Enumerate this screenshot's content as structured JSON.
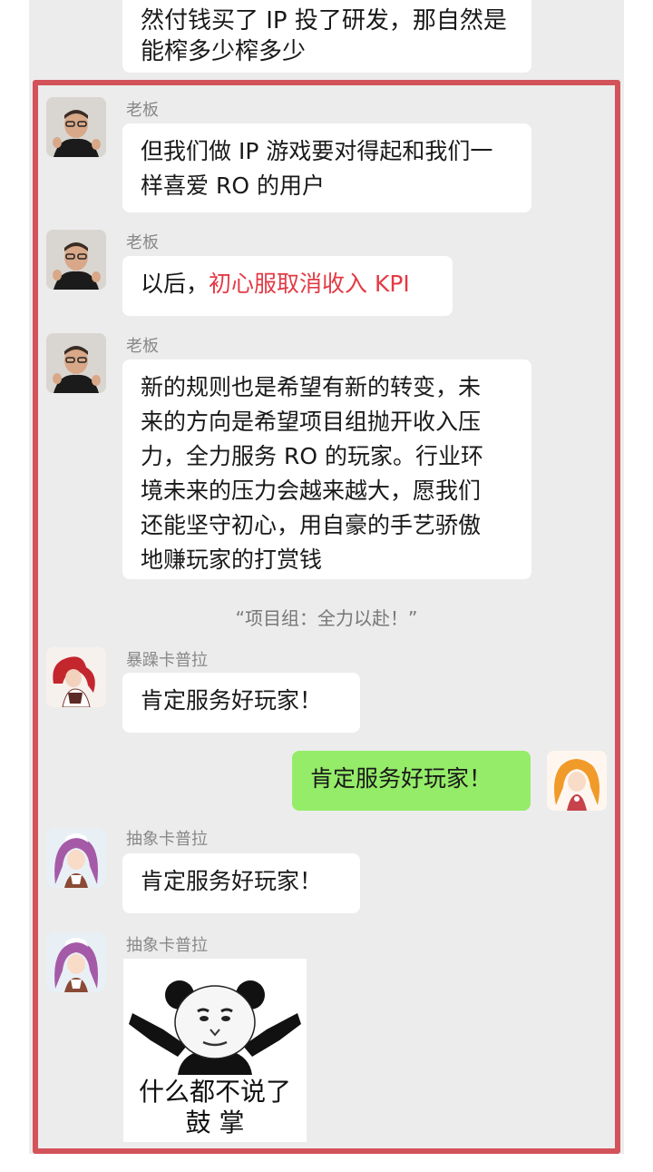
{
  "previous_message": {
    "line1": "然付钱买了 IP 投了研发，那自然是",
    "line2": "能榨多少榨多少"
  },
  "messages": [
    {
      "sender": "老板",
      "line1": "但我们做 IP 游戏要对得起和我们一",
      "line2": "样喜爱 RO 的用户"
    },
    {
      "sender": "老板",
      "prefix": "以后，",
      "highlight": "初心服取消收入 KPI"
    },
    {
      "sender": "老板",
      "lines": [
        "新的规则也是希望有新的转变，未",
        "来的方向是希望项目组抛开收入压",
        "力，全力服务 RO 的玩家。行业环",
        "境未来的压力会越来越大，愿我们",
        "还能坚守初心，用自豪的手艺骄傲",
        "地赚玩家的打赏钱"
      ]
    },
    {
      "sender": "暴躁卡普拉",
      "text": "肯定服务好玩家！"
    },
    {
      "sender": "抽象卡普拉",
      "text": "肯定服务好玩家！"
    },
    {
      "sender": "抽象卡普拉",
      "sticker_line1": "什么都不说了",
      "sticker_line2": "鼓 掌"
    }
  ],
  "system_notice": "“项目组：全力以赴！”",
  "self_message": {
    "text": "肯定服务好玩家！"
  },
  "colors": {
    "highlight_border": "#d3535a",
    "self_bubble": "#95ec69",
    "accent_red": "#e33a45",
    "chat_background": "#ececec"
  },
  "icons": {
    "boss_avatar": "boss-avatar",
    "kapura_red_avatar": "kapura-red-avatar",
    "kapura_purple_avatar": "kapura-purple-avatar",
    "self_avatar": "self-orange-hair-avatar",
    "sticker": "panda-clapping-sticker"
  }
}
